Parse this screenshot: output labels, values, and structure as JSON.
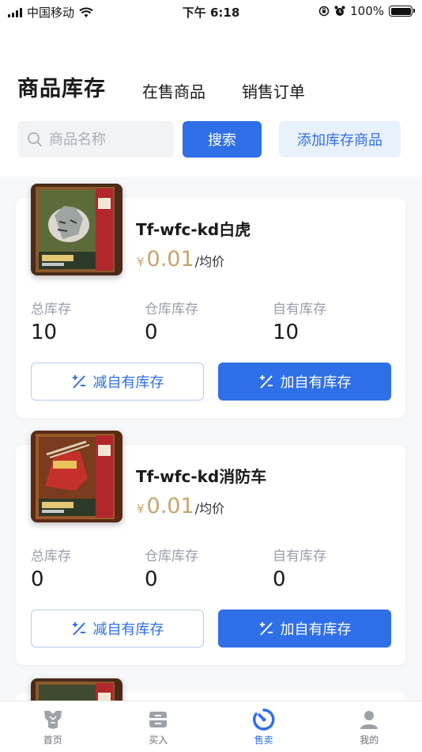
{
  "status_bar": {
    "carrier": "中国移动",
    "time": "下午 6:18",
    "battery": "100%"
  },
  "tabs": [
    {
      "label": "商品库存",
      "active": true
    },
    {
      "label": "在售商品",
      "active": false
    },
    {
      "label": "销售订单",
      "active": false
    }
  ],
  "search": {
    "placeholder": "商品名称",
    "search_label": "搜索",
    "add_label": "添加库存商品"
  },
  "stat_labels": {
    "total": "总库存",
    "warehouse": "仓库库存",
    "own": "自有库存"
  },
  "buttons": {
    "decrease": "减自有库存",
    "increase": "加自有库存"
  },
  "products": [
    {
      "name": "Tf-wfc-kd白虎",
      "currency": "¥",
      "price": "0.01",
      "price_unit": "/均价",
      "total": "10",
      "warehouse": "0",
      "own": "10"
    },
    {
      "name": "Tf-wfc-kd消防车",
      "currency": "¥",
      "price": "0.01",
      "price_unit": "/均价",
      "total": "0",
      "warehouse": "0",
      "own": "0"
    }
  ],
  "tabbar": [
    {
      "label": "首页",
      "icon": "transformers-logo-icon",
      "active": false
    },
    {
      "label": "买入",
      "icon": "inbox-icon",
      "active": false
    },
    {
      "label": "售卖",
      "icon": "timer-icon",
      "active": true
    },
    {
      "label": "我的",
      "icon": "user-icon",
      "active": false
    }
  ],
  "colors": {
    "primary": "#2f6fe8",
    "primary_light": "#e9f1fd",
    "price": "#c7a46b",
    "muted": "#9aa0ab"
  }
}
